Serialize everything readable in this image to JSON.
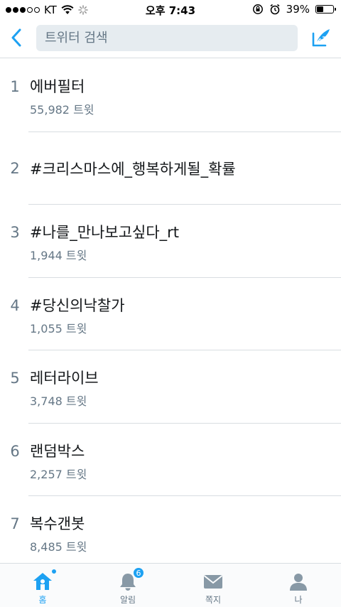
{
  "status_bar": {
    "carrier": "KT",
    "time": "오후 7:43",
    "battery_percent": "39%",
    "battery_level": 0.39
  },
  "search": {
    "placeholder": "트위터 검색"
  },
  "trends": [
    {
      "rank": "1",
      "name": "에버필터",
      "count": "55,982 트윗"
    },
    {
      "rank": "2",
      "name": "#크리스마스에_행복하게될_확률",
      "count": ""
    },
    {
      "rank": "3",
      "name": "#나를_만나보고싶다_rt",
      "count": "1,944 트윗"
    },
    {
      "rank": "4",
      "name": "#당신의낙찰가",
      "count": "1,055 트윗"
    },
    {
      "rank": "5",
      "name": "레터라이브",
      "count": "3,748 트윗"
    },
    {
      "rank": "6",
      "name": "랜덤박스",
      "count": "2,257 트윗"
    },
    {
      "rank": "7",
      "name": "복수갠봇",
      "count": "8,485 트윗"
    }
  ],
  "tabs": [
    {
      "label": "홈",
      "icon": "home-icon",
      "active": true
    },
    {
      "label": "알림",
      "icon": "bell-icon",
      "badge": "6"
    },
    {
      "label": "쪽지",
      "icon": "envelope-icon"
    },
    {
      "label": "나",
      "icon": "person-icon"
    }
  ],
  "colors": {
    "accent": "#1da1f2",
    "text_secondary": "#657786",
    "divider": "#d8dde1",
    "search_bg": "#e6ecf0"
  }
}
